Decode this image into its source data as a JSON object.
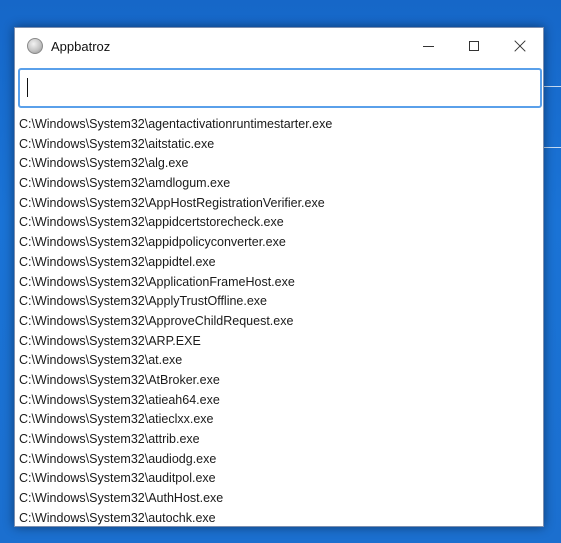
{
  "window": {
    "title": "Appbatroz",
    "icon": "app-circle-icon"
  },
  "controls": {
    "minimize": "minimize-icon",
    "maximize": "maximize-icon",
    "close": "close-icon"
  },
  "search": {
    "value": "",
    "placeholder": ""
  },
  "results": [
    "C:\\Windows\\System32\\agentactivationruntimestarter.exe",
    "C:\\Windows\\System32\\aitstatic.exe",
    "C:\\Windows\\System32\\alg.exe",
    "C:\\Windows\\System32\\amdlogum.exe",
    "C:\\Windows\\System32\\AppHostRegistrationVerifier.exe",
    "C:\\Windows\\System32\\appidcertstorecheck.exe",
    "C:\\Windows\\System32\\appidpolicyconverter.exe",
    "C:\\Windows\\System32\\appidtel.exe",
    "C:\\Windows\\System32\\ApplicationFrameHost.exe",
    "C:\\Windows\\System32\\ApplyTrustOffline.exe",
    "C:\\Windows\\System32\\ApproveChildRequest.exe",
    "C:\\Windows\\System32\\ARP.EXE",
    "C:\\Windows\\System32\\at.exe",
    "C:\\Windows\\System32\\AtBroker.exe",
    "C:\\Windows\\System32\\atieah64.exe",
    "C:\\Windows\\System32\\atieclxx.exe",
    "C:\\Windows\\System32\\attrib.exe",
    "C:\\Windows\\System32\\audiodg.exe",
    "C:\\Windows\\System32\\auditpol.exe",
    "C:\\Windows\\System32\\AuthHost.exe",
    "C:\\Windows\\System32\\autochk.exe"
  ],
  "colors": {
    "desktop": "#1a6fd0",
    "focus_border": "#5aa0ea"
  }
}
